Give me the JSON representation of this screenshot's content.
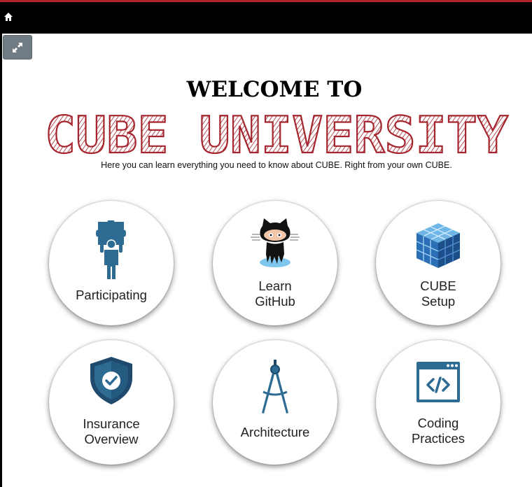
{
  "header": {
    "title_line1": "WELCOME TO",
    "logo_text": "CUBE UNIVERSITY",
    "tagline": "Here you can learn everything you need to know about CUBE. Right from your own CUBE."
  },
  "tiles": [
    {
      "label": "Participating",
      "icon": "puzzle-person-icon"
    },
    {
      "label": "Learn\nGitHub",
      "icon": "github-octocat-icon"
    },
    {
      "label": "CUBE\nSetup",
      "icon": "cube-icon"
    },
    {
      "label": "Insurance\nOverview",
      "icon": "shield-check-icon"
    },
    {
      "label": "Architecture",
      "icon": "compass-icon"
    },
    {
      "label": "Coding\nPractices",
      "icon": "code-window-icon"
    }
  ],
  "colors": {
    "accent": "#b0232a",
    "logo": "#a5262e",
    "topbar": "#000000",
    "icon_blue": "#2e6b92"
  }
}
